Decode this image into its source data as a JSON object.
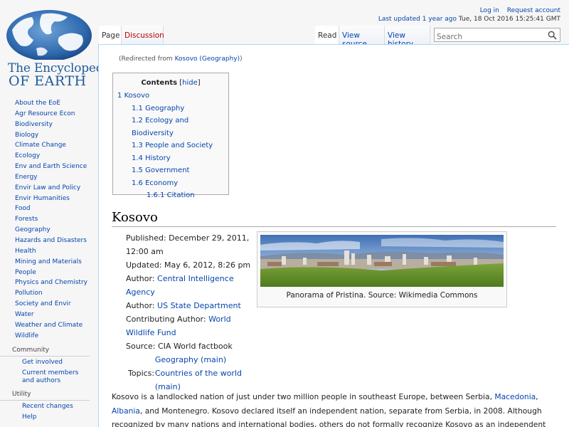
{
  "personal": {
    "login": "Log in",
    "request_account": "Request account",
    "last_updated": "Last updated",
    "ago": "1 year ago",
    "timestamp": "Tue, 18 Oct 2016 15:25:41 GMT"
  },
  "logo": {
    "line1": "The Encyclopedia",
    "line2": "OF EARTH"
  },
  "tabs": {
    "page": "Page",
    "discussion": "Discussion",
    "read": "Read",
    "view_source": "View source",
    "view_history": "View history"
  },
  "search": {
    "placeholder": "Search"
  },
  "sidebar": {
    "topics": [
      "About the EoE",
      "Agr Resource Econ",
      "Biodiversity",
      "Biology",
      "Climate Change",
      "Ecology",
      "Env and Earth Science",
      "Energy",
      "Envir Law and Policy",
      "Envir Humanities",
      "Food",
      "Forests",
      "Geography",
      "Hazards and Disasters",
      "Health",
      "Mining and Materials",
      "People",
      "Physics and Chemistry",
      "Pollution",
      "Society and Envir",
      "Water",
      "Weather and Climate",
      "Wildlife"
    ],
    "community": {
      "title": "Community",
      "items": [
        "Get involved",
        "Current members and authors"
      ]
    },
    "utility": {
      "title": "Utility",
      "items": [
        "Recent changes",
        "Help"
      ]
    }
  },
  "content": {
    "redirect_prefix": "(Redirected from",
    "redirect_link": "Kosovo (Geography)",
    "redirect_suffix": ")",
    "toc": {
      "title": "Contents",
      "hide": "hide",
      "items": [
        {
          "num": "1",
          "text": "Kosovo",
          "level": 1
        },
        {
          "num": "1.1",
          "text": "Geography",
          "level": 2
        },
        {
          "num": "1.2",
          "text": "Ecology and Biodiversity",
          "level": 2
        },
        {
          "num": "1.3",
          "text": "People and Society",
          "level": 2
        },
        {
          "num": "1.4",
          "text": "History",
          "level": 2
        },
        {
          "num": "1.5",
          "text": "Government",
          "level": 2
        },
        {
          "num": "1.6",
          "text": "Economy",
          "level": 2
        },
        {
          "num": "1.6.1",
          "text": "Citation",
          "level": 3
        }
      ]
    },
    "heading": "Kosovo",
    "meta": {
      "published_label": "Published:",
      "published": "December 29, 2011, 12:00 am",
      "updated_label": "Updated:",
      "updated": "May 6, 2012, 8:26 pm",
      "author_label": "Author:",
      "author1": "Central Intelligence Agency",
      "author2": "US State Department",
      "contrib_label": "Contributing Author:",
      "contrib": "World Wildlife Fund",
      "source_label": "Source:",
      "source": "CIA World factbook",
      "topics_label": "Topics:",
      "topics": [
        "Geography (main)",
        "Countries of the world (main)"
      ]
    },
    "thumb_caption": "Panorama of Pristina. Source: Wikimedia Commons",
    "body": {
      "t1": "Kosovo is a landlocked nation of just under two million people in southeast Europe, between Serbia, ",
      "link1": "Macedonia",
      "t2": ", ",
      "link2": "Albania",
      "t3": ", and Montenegro. Kosovo declared itself an independent nation, separate from Serbia, in 2008. Although recognized by many nations and international bodies, others do not formally recognize Kosovo as an independent nation, separate from Serbia."
    }
  }
}
